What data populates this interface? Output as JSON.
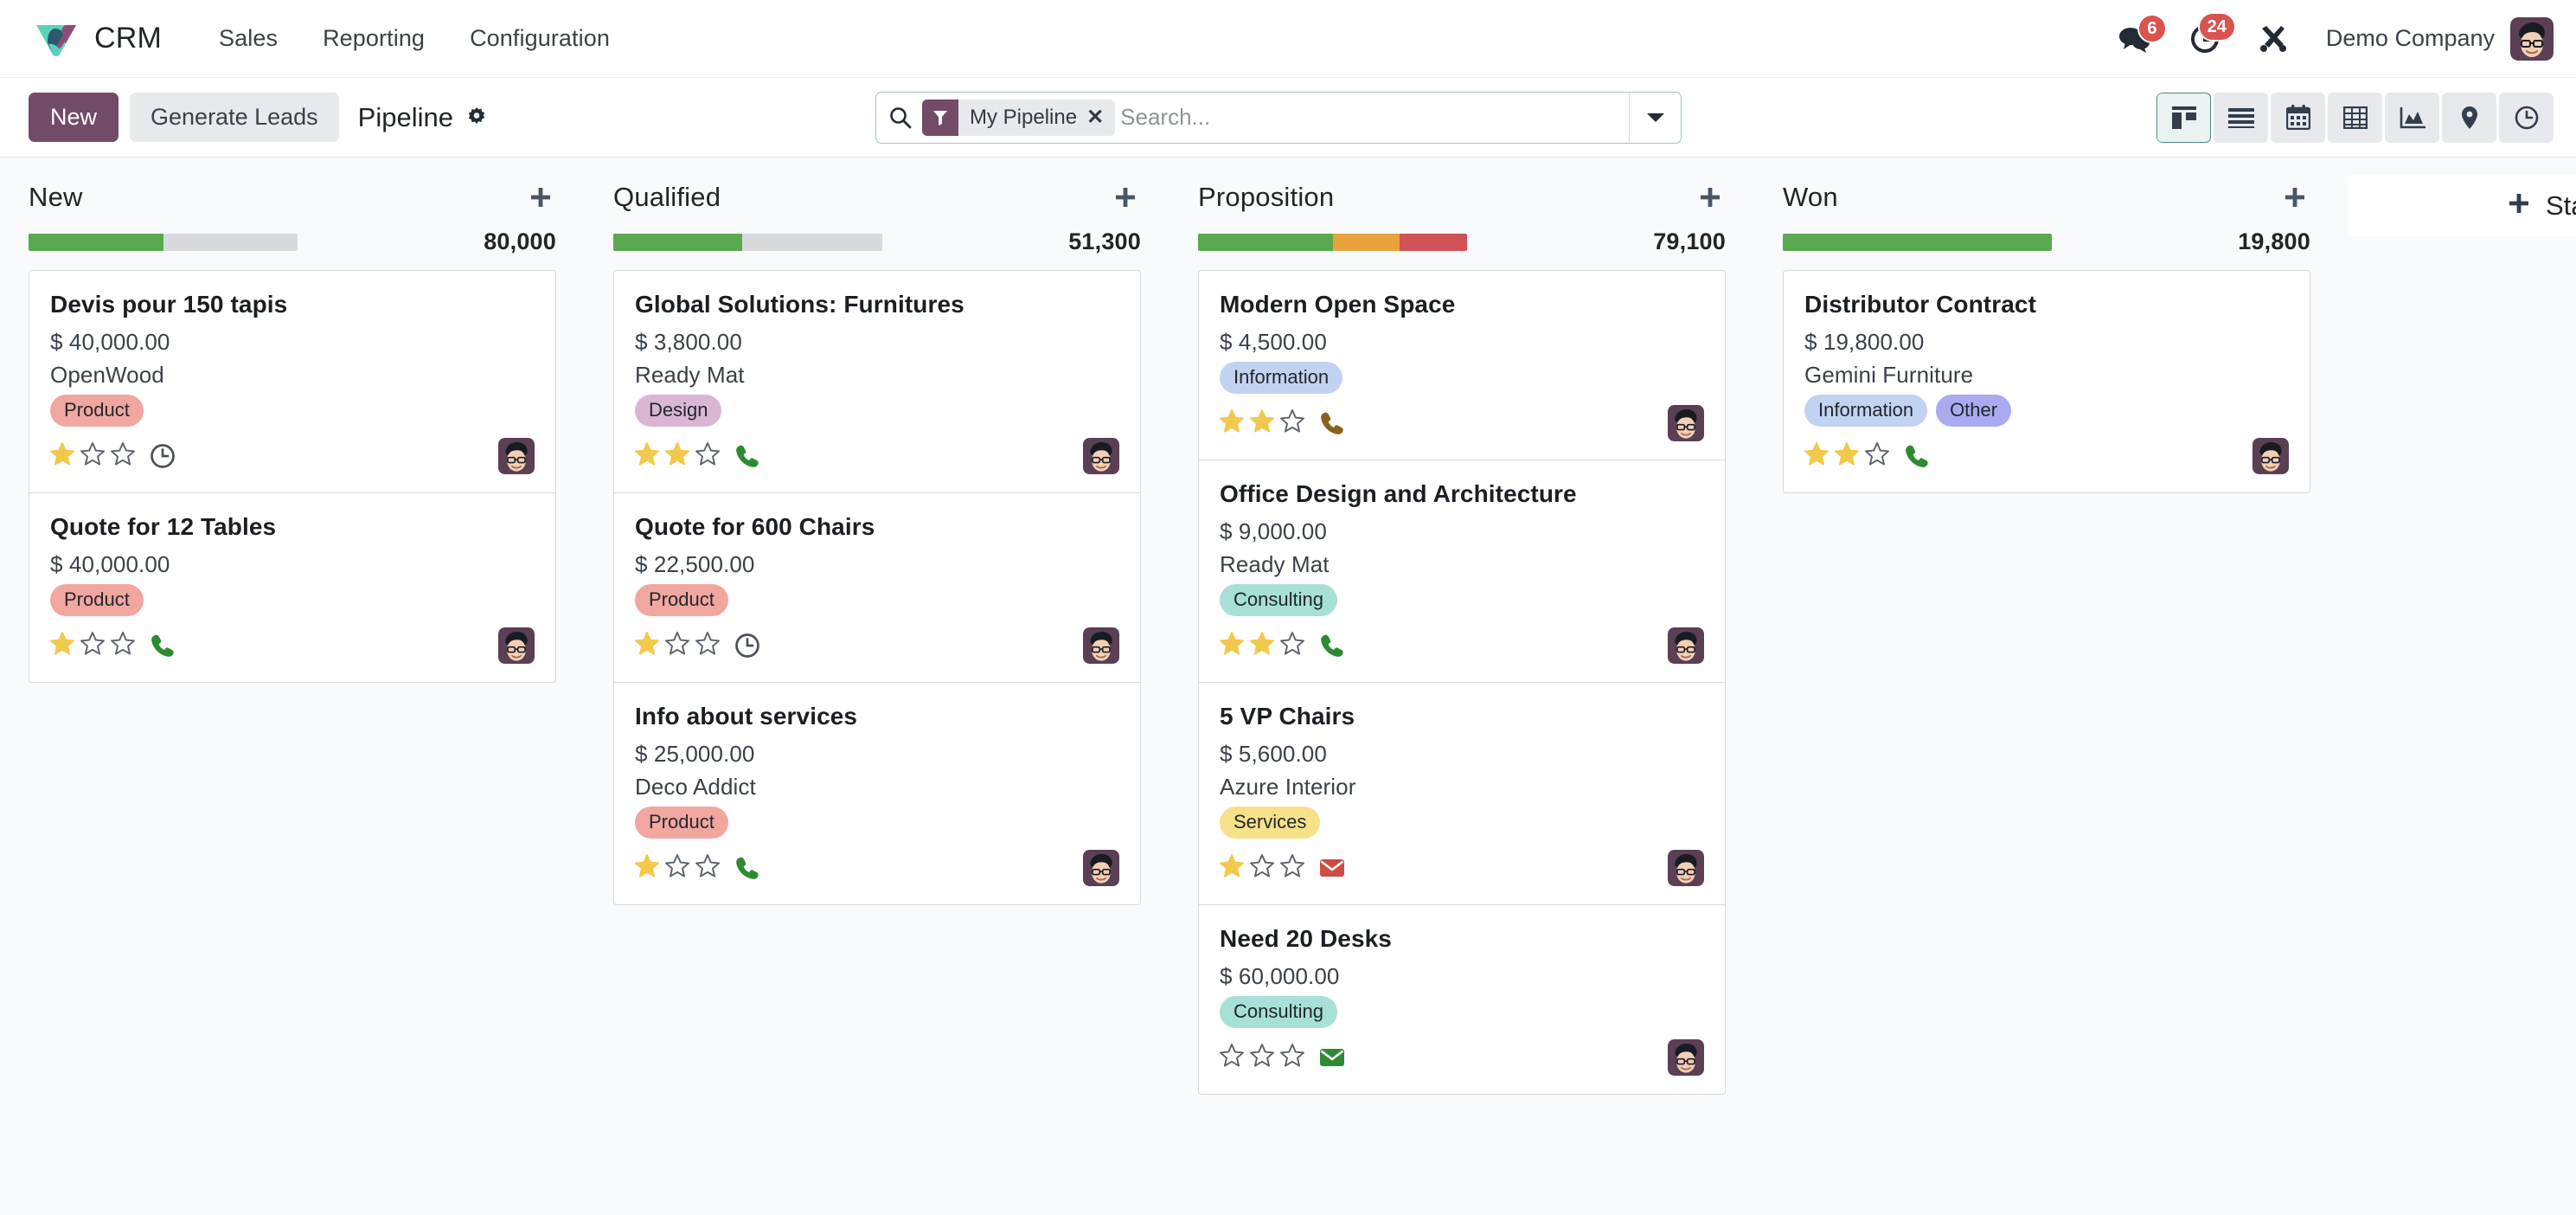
{
  "navbar": {
    "brand": "CRM",
    "logo_icon": "odoo-crm-logo-icon",
    "links": [
      {
        "label": "Sales"
      },
      {
        "label": "Reporting"
      },
      {
        "label": "Configuration"
      }
    ],
    "messages_icon": "chat-bubbles-icon",
    "messages_count": "6",
    "activities_icon": "clock-icon",
    "activities_count": "24",
    "debug_icon": "tools-icon",
    "company": "Demo Company",
    "avatar_icon": "user-avatar-icon"
  },
  "control_panel": {
    "new_label": "New",
    "generate_leads_label": "Generate Leads",
    "breadcrumb": "Pipeline",
    "gear_icon": "gear-icon",
    "search": {
      "search_icon": "search-icon",
      "filter_icon": "filter-funnel-icon",
      "facet_label": "My Pipeline",
      "facet_remove_icon": "close-x-icon",
      "placeholder": "Search...",
      "value": "",
      "dropdown_icon": "chevron-down-icon"
    },
    "views": [
      {
        "name": "kanban",
        "icon": "kanban-icon",
        "active": true
      },
      {
        "name": "list",
        "icon": "list-icon",
        "active": false
      },
      {
        "name": "calendar",
        "icon": "calendar-icon",
        "active": false
      },
      {
        "name": "pivot",
        "icon": "pivot-table-icon",
        "active": false
      },
      {
        "name": "graph",
        "icon": "area-chart-icon",
        "active": false
      },
      {
        "name": "map",
        "icon": "map-pin-icon",
        "active": false
      },
      {
        "name": "activity",
        "icon": "clock-icon",
        "active": false
      }
    ]
  },
  "kanban": {
    "add_column": {
      "plus_icon": "plus-icon",
      "label": "Stage"
    },
    "columns": [
      {
        "title": "New",
        "plus_icon": "plus-icon",
        "total": "80,000",
        "progress": [
          {
            "color": "#5aa84f",
            "pct": 50
          },
          {
            "color": "#d8dadd",
            "pct": 50
          }
        ],
        "cards": [
          {
            "title": "Devis pour 150 tapis",
            "amount": "$ 40,000.00",
            "customer": "OpenWood",
            "tags": [
              {
                "label": "Product",
                "bg": "#f2a6a0",
                "fg": "#23272c"
              }
            ],
            "stars": 1,
            "activity_icon": "clock-icon",
            "activity_color": "#4a5159",
            "avatar_icon": "user-avatar-icon"
          },
          {
            "title": "Quote for 12 Tables",
            "amount": "$ 40,000.00",
            "customer": "",
            "tags": [
              {
                "label": "Product",
                "bg": "#f2a6a0",
                "fg": "#23272c"
              }
            ],
            "stars": 1,
            "activity_icon": "phone-icon",
            "activity_color": "#2e8b32",
            "avatar_icon": "user-avatar-icon"
          }
        ]
      },
      {
        "title": "Qualified",
        "plus_icon": "plus-icon",
        "total": "51,300",
        "progress": [
          {
            "color": "#5aa84f",
            "pct": 48
          },
          {
            "color": "#d8dadd",
            "pct": 52
          }
        ],
        "cards": [
          {
            "title": "Global Solutions: Furnitures",
            "amount": "$ 3,800.00",
            "customer": "Ready Mat",
            "tags": [
              {
                "label": "Design",
                "bg": "#d9b6d4",
                "fg": "#23272c"
              }
            ],
            "stars": 2,
            "activity_icon": "phone-icon",
            "activity_color": "#2e8b32",
            "avatar_icon": "user-avatar-icon"
          },
          {
            "title": "Quote for 600 Chairs",
            "amount": "$ 22,500.00",
            "customer": "",
            "tags": [
              {
                "label": "Product",
                "bg": "#f2a6a0",
                "fg": "#23272c"
              }
            ],
            "stars": 1,
            "activity_icon": "clock-icon",
            "activity_color": "#4a5159",
            "avatar_icon": "user-avatar-icon"
          },
          {
            "title": "Info about services",
            "amount": "$ 25,000.00",
            "customer": "Deco Addict",
            "tags": [
              {
                "label": "Product",
                "bg": "#f2a6a0",
                "fg": "#23272c"
              }
            ],
            "stars": 1,
            "activity_icon": "phone-icon",
            "activity_color": "#2e8b32",
            "avatar_icon": "user-avatar-icon"
          }
        ]
      },
      {
        "title": "Proposition",
        "plus_icon": "plus-icon",
        "total": "79,100",
        "progress": [
          {
            "color": "#5aa84f",
            "pct": 50
          },
          {
            "color": "#e8a33d",
            "pct": 25
          },
          {
            "color": "#cf5257",
            "pct": 25
          }
        ],
        "cards": [
          {
            "title": "Modern Open Space",
            "amount": "$ 4,500.00",
            "customer": "",
            "tags": [
              {
                "label": "Information",
                "bg": "#c2d3f2",
                "fg": "#23272c"
              }
            ],
            "stars": 2,
            "activity_icon": "phone-icon",
            "activity_color": "#8a6118",
            "avatar_icon": "user-avatar-icon"
          },
          {
            "title": "Office Design and Architecture",
            "amount": "$ 9,000.00",
            "customer": "Ready Mat",
            "tags": [
              {
                "label": "Consulting",
                "bg": "#a6e0d6",
                "fg": "#23272c"
              }
            ],
            "stars": 2,
            "activity_icon": "phone-icon",
            "activity_color": "#2e8b32",
            "avatar_icon": "user-avatar-icon"
          },
          {
            "title": "5 VP Chairs",
            "amount": "$ 5,600.00",
            "customer": "Azure Interior",
            "tags": [
              {
                "label": "Services",
                "bg": "#f6e18b",
                "fg": "#23272c"
              }
            ],
            "stars": 1,
            "activity_icon": "envelope-icon",
            "activity_color": "#cc4b43",
            "avatar_icon": "user-avatar-icon"
          },
          {
            "title": "Need 20 Desks",
            "amount": "$ 60,000.00",
            "customer": "",
            "tags": [
              {
                "label": "Consulting",
                "bg": "#a6e0d6",
                "fg": "#23272c"
              }
            ],
            "stars": 0,
            "activity_icon": "envelope-icon",
            "activity_color": "#2e8b32",
            "avatar_icon": "user-avatar-icon"
          }
        ]
      },
      {
        "title": "Won",
        "plus_icon": "plus-icon",
        "total": "19,800",
        "progress": [
          {
            "color": "#5aa84f",
            "pct": 100
          }
        ],
        "cards": [
          {
            "title": "Distributor Contract",
            "amount": "$ 19,800.00",
            "customer": "Gemini Furniture",
            "tags": [
              {
                "label": "Information",
                "bg": "#c2d3f2",
                "fg": "#23272c"
              },
              {
                "label": "Other",
                "bg": "#a9aaf0",
                "fg": "#23272c"
              }
            ],
            "stars": 2,
            "activity_icon": "phone-icon",
            "activity_color": "#2e8b32",
            "avatar_icon": "user-avatar-icon"
          }
        ]
      }
    ]
  },
  "colors": {
    "brand_purple": "#714b67",
    "accent_teal": "#4a8a84",
    "star_filled": "#f2c94c",
    "star_empty": "#5b6169",
    "badge_red": "#d9534f"
  }
}
